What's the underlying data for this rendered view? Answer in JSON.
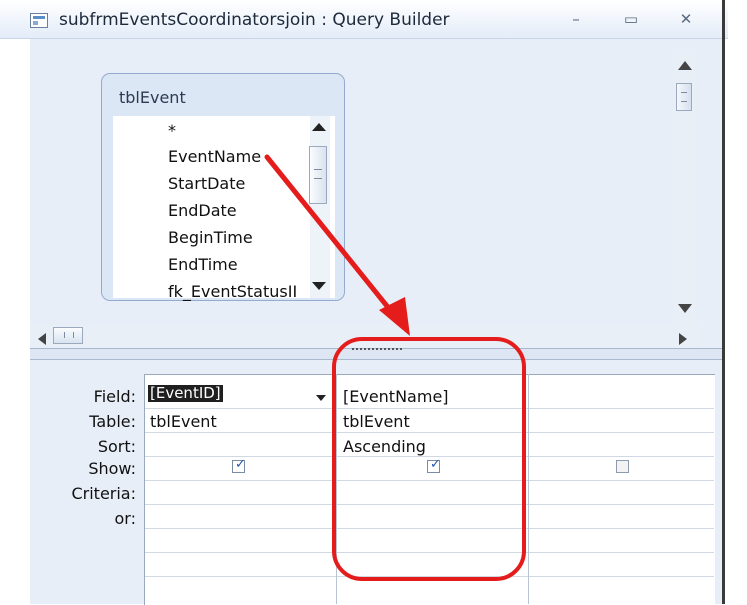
{
  "window": {
    "title": "subfrmEventsCoordinatorsjoin : Query Builder",
    "icon": "query-builder-icon",
    "buttons": {
      "minimize": "–",
      "maximize": "▭",
      "close": "✕"
    }
  },
  "table_box": {
    "title": "tblEvent",
    "fields": [
      "*",
      "EventName",
      "StartDate",
      "EndDate",
      "BeginTime",
      "EndTime",
      "fk_EventStatusII"
    ]
  },
  "grid": {
    "row_labels": [
      "Field:",
      "Table:",
      "Sort:",
      "Show:",
      "Criteria:",
      "or:"
    ],
    "columns": [
      {
        "field": "[EventID]",
        "table": "tblEvent",
        "sort": "",
        "show": true
      },
      {
        "field": "[EventName]",
        "table": "tblEvent",
        "sort": "Ascending",
        "show": true
      },
      {
        "field": "",
        "table": "",
        "sort": "",
        "show": false
      }
    ]
  },
  "annotation": {
    "arrow_color": "#e51c1c",
    "highlight_color": "#e51c1c"
  },
  "colors": {
    "pane_bg": "#e7eef8",
    "table_box_bg": "#dce7f5",
    "checkmark": "#2256b0"
  }
}
